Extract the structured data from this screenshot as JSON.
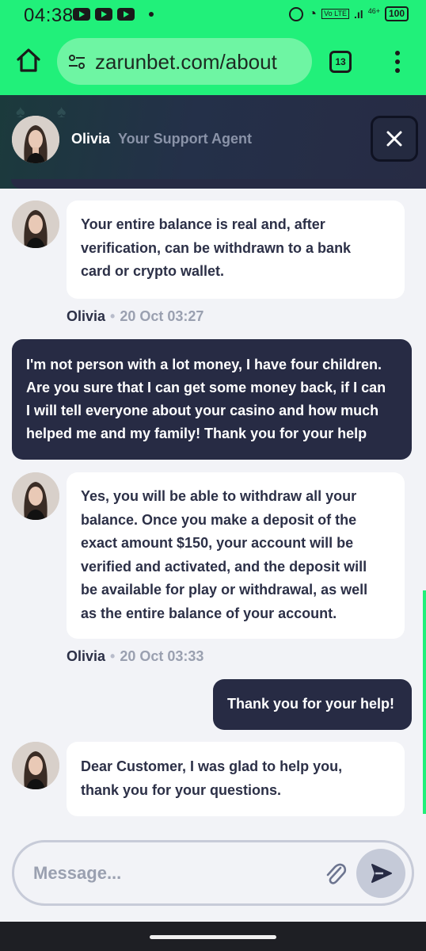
{
  "status_bar": {
    "time": "04:38",
    "network": "46+",
    "volte": "Vo LTE",
    "battery": "100"
  },
  "browser": {
    "url": "zarunbet.com/about",
    "tab_count": "13"
  },
  "chat_header": {
    "agent_name": "Olivia",
    "agent_role": "Your Support Agent"
  },
  "messages": [
    {
      "from": "agent",
      "text_lines": [
        "Your entire balance is real and, after",
        "verification, can be withdrawn to a bank",
        "card or crypto wallet."
      ],
      "sender": "Olivia",
      "time": "20 Oct 03:27"
    },
    {
      "from": "user",
      "text_lines": [
        "I'm not person with a lot money, I have four children.",
        "Are you sure that I can get some money back, if I can",
        "I will tell everyone about your casino and how much",
        "helped me and my family! Thank you for your help"
      ]
    },
    {
      "from": "agent",
      "text_lines": [
        "Yes, you will be able to withdraw all your",
        "balance. Once you make a deposit of the",
        "exact amount $150, your account will be",
        "verified and activated, and the deposit will",
        "be available for play or withdrawal, as well",
        "as the entire balance of your account."
      ],
      "sender": "Olivia",
      "time": "20 Oct 03:33"
    },
    {
      "from": "user",
      "text_lines": [
        "Thank you for your help!"
      ]
    },
    {
      "from": "agent",
      "text_lines": [
        "Dear Customer, I was glad to help you,",
        "thank you for your questions."
      ]
    }
  ],
  "composer": {
    "placeholder": "Message..."
  },
  "colors": {
    "browser_accent": "#21f07a",
    "chat_dark": "#272b44",
    "bubble_light": "#ffffff"
  }
}
